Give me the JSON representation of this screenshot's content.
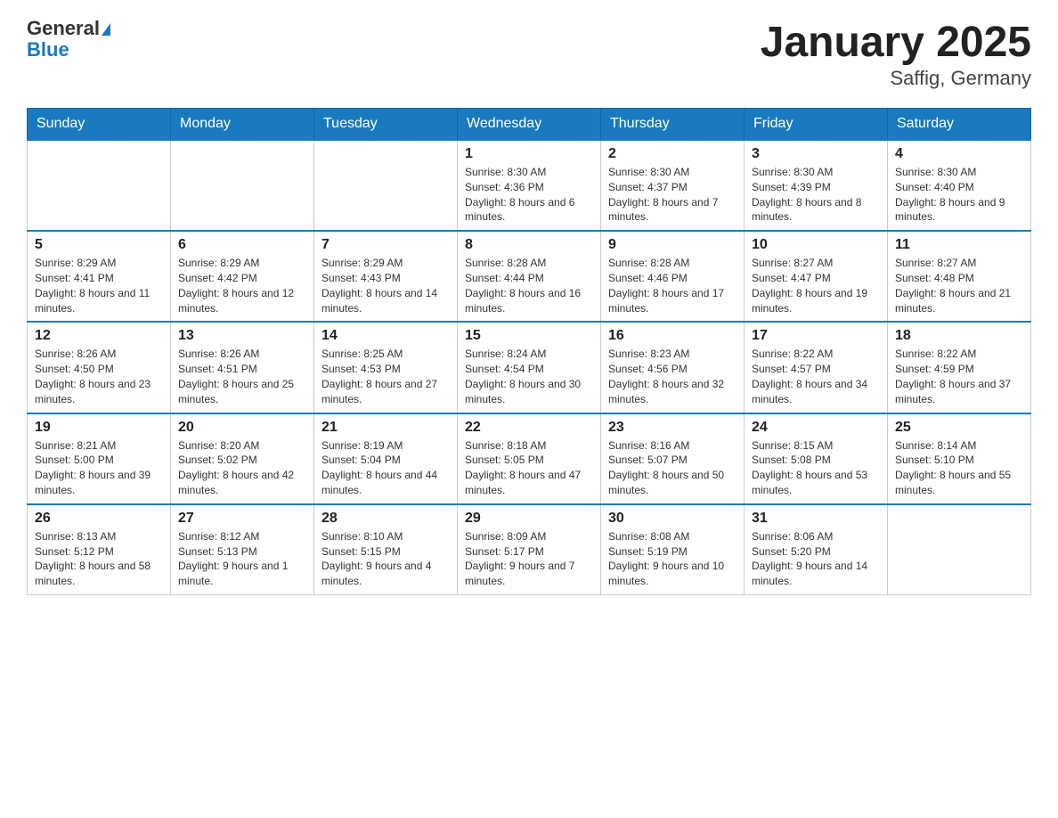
{
  "header": {
    "logo_general": "General",
    "logo_blue": "Blue",
    "title": "January 2025",
    "subtitle": "Saffig, Germany"
  },
  "weekdays": [
    "Sunday",
    "Monday",
    "Tuesday",
    "Wednesday",
    "Thursday",
    "Friday",
    "Saturday"
  ],
  "weeks": [
    [
      {
        "day": "",
        "info": ""
      },
      {
        "day": "",
        "info": ""
      },
      {
        "day": "",
        "info": ""
      },
      {
        "day": "1",
        "info": "Sunrise: 8:30 AM\nSunset: 4:36 PM\nDaylight: 8 hours and 6 minutes."
      },
      {
        "day": "2",
        "info": "Sunrise: 8:30 AM\nSunset: 4:37 PM\nDaylight: 8 hours and 7 minutes."
      },
      {
        "day": "3",
        "info": "Sunrise: 8:30 AM\nSunset: 4:39 PM\nDaylight: 8 hours and 8 minutes."
      },
      {
        "day": "4",
        "info": "Sunrise: 8:30 AM\nSunset: 4:40 PM\nDaylight: 8 hours and 9 minutes."
      }
    ],
    [
      {
        "day": "5",
        "info": "Sunrise: 8:29 AM\nSunset: 4:41 PM\nDaylight: 8 hours and 11 minutes."
      },
      {
        "day": "6",
        "info": "Sunrise: 8:29 AM\nSunset: 4:42 PM\nDaylight: 8 hours and 12 minutes."
      },
      {
        "day": "7",
        "info": "Sunrise: 8:29 AM\nSunset: 4:43 PM\nDaylight: 8 hours and 14 minutes."
      },
      {
        "day": "8",
        "info": "Sunrise: 8:28 AM\nSunset: 4:44 PM\nDaylight: 8 hours and 16 minutes."
      },
      {
        "day": "9",
        "info": "Sunrise: 8:28 AM\nSunset: 4:46 PM\nDaylight: 8 hours and 17 minutes."
      },
      {
        "day": "10",
        "info": "Sunrise: 8:27 AM\nSunset: 4:47 PM\nDaylight: 8 hours and 19 minutes."
      },
      {
        "day": "11",
        "info": "Sunrise: 8:27 AM\nSunset: 4:48 PM\nDaylight: 8 hours and 21 minutes."
      }
    ],
    [
      {
        "day": "12",
        "info": "Sunrise: 8:26 AM\nSunset: 4:50 PM\nDaylight: 8 hours and 23 minutes."
      },
      {
        "day": "13",
        "info": "Sunrise: 8:26 AM\nSunset: 4:51 PM\nDaylight: 8 hours and 25 minutes."
      },
      {
        "day": "14",
        "info": "Sunrise: 8:25 AM\nSunset: 4:53 PM\nDaylight: 8 hours and 27 minutes."
      },
      {
        "day": "15",
        "info": "Sunrise: 8:24 AM\nSunset: 4:54 PM\nDaylight: 8 hours and 30 minutes."
      },
      {
        "day": "16",
        "info": "Sunrise: 8:23 AM\nSunset: 4:56 PM\nDaylight: 8 hours and 32 minutes."
      },
      {
        "day": "17",
        "info": "Sunrise: 8:22 AM\nSunset: 4:57 PM\nDaylight: 8 hours and 34 minutes."
      },
      {
        "day": "18",
        "info": "Sunrise: 8:22 AM\nSunset: 4:59 PM\nDaylight: 8 hours and 37 minutes."
      }
    ],
    [
      {
        "day": "19",
        "info": "Sunrise: 8:21 AM\nSunset: 5:00 PM\nDaylight: 8 hours and 39 minutes."
      },
      {
        "day": "20",
        "info": "Sunrise: 8:20 AM\nSunset: 5:02 PM\nDaylight: 8 hours and 42 minutes."
      },
      {
        "day": "21",
        "info": "Sunrise: 8:19 AM\nSunset: 5:04 PM\nDaylight: 8 hours and 44 minutes."
      },
      {
        "day": "22",
        "info": "Sunrise: 8:18 AM\nSunset: 5:05 PM\nDaylight: 8 hours and 47 minutes."
      },
      {
        "day": "23",
        "info": "Sunrise: 8:16 AM\nSunset: 5:07 PM\nDaylight: 8 hours and 50 minutes."
      },
      {
        "day": "24",
        "info": "Sunrise: 8:15 AM\nSunset: 5:08 PM\nDaylight: 8 hours and 53 minutes."
      },
      {
        "day": "25",
        "info": "Sunrise: 8:14 AM\nSunset: 5:10 PM\nDaylight: 8 hours and 55 minutes."
      }
    ],
    [
      {
        "day": "26",
        "info": "Sunrise: 8:13 AM\nSunset: 5:12 PM\nDaylight: 8 hours and 58 minutes."
      },
      {
        "day": "27",
        "info": "Sunrise: 8:12 AM\nSunset: 5:13 PM\nDaylight: 9 hours and 1 minute."
      },
      {
        "day": "28",
        "info": "Sunrise: 8:10 AM\nSunset: 5:15 PM\nDaylight: 9 hours and 4 minutes."
      },
      {
        "day": "29",
        "info": "Sunrise: 8:09 AM\nSunset: 5:17 PM\nDaylight: 9 hours and 7 minutes."
      },
      {
        "day": "30",
        "info": "Sunrise: 8:08 AM\nSunset: 5:19 PM\nDaylight: 9 hours and 10 minutes."
      },
      {
        "day": "31",
        "info": "Sunrise: 8:06 AM\nSunset: 5:20 PM\nDaylight: 9 hours and 14 minutes."
      },
      {
        "day": "",
        "info": ""
      }
    ]
  ]
}
